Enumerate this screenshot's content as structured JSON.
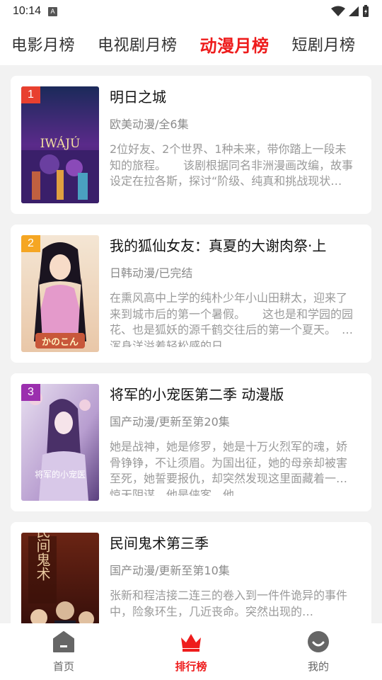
{
  "status_bar": {
    "time": "10:14",
    "notification_letter": "A"
  },
  "tabs": [
    {
      "label": "电影月榜",
      "active": false
    },
    {
      "label": "电视剧月榜",
      "active": false
    },
    {
      "label": "动漫月榜",
      "active": true
    },
    {
      "label": "短剧月榜",
      "active": false
    }
  ],
  "items": [
    {
      "rank": "1",
      "rank_color": "#e8402f",
      "title": "明日之城",
      "meta": "欧美动漫/全6集",
      "description": "2位好友、2个世界、1种未来，带你踏上一段未知的旅程。　　该剧根据同名非洲漫画改编，故事设定在拉各斯，探讨“阶级、纯真和挑战现状…",
      "poster_text": "IWÁJÚ",
      "poster_colors": [
        "#2a1650",
        "#6a2ea0"
      ]
    },
    {
      "rank": "2",
      "rank_color": "#f5a623",
      "title": "我的狐仙女友：真夏的大谢肉祭·上",
      "meta": "日韩动漫/已完结",
      "description": "在熏风高中上学的纯朴少年小山田耕太，迎来了来到城市后的第一个暑假。　　这也是和学园的园花、也是狐妖的源千鹤交往后的第一个夏天。　　浑身洋溢着轻松感的日…",
      "poster_text": "かのこん",
      "poster_colors": [
        "#f3e2cf",
        "#d98fc0"
      ]
    },
    {
      "rank": "3",
      "rank_color": "#9b2fae",
      "title": "将军的小宠医第二季 动漫版",
      "meta": "国产动漫/更新至第20集",
      "description": "她是战神，她是修罗，她是十万火烈军的魂，娇骨铮铮，不让须眉。为国出征，她的母亲却被害至死，她誓要报仇，却突然发现这里面藏着一个惊天阴谋。他是侠客，他…",
      "poster_text": "将军的小宠医",
      "poster_colors": [
        "#d8cde6",
        "#7b5a9e"
      ]
    },
    {
      "rank": "",
      "rank_color": "",
      "title": "民间鬼术第三季",
      "meta": "国产动漫/更新至第10集",
      "description": "张新和程洁接二连三的卷入到一件件诡异的事件中，险象环生，几近丧命。突然出现的…",
      "poster_text": "民间鬼术",
      "poster_colors": [
        "#5a1a12",
        "#2a0a08"
      ]
    }
  ],
  "bottom_nav": [
    {
      "label": "首页",
      "icon": "home-icon",
      "active": false
    },
    {
      "label": "排行榜",
      "icon": "crown-icon",
      "active": true
    },
    {
      "label": "我的",
      "icon": "profile-icon",
      "active": false
    }
  ],
  "colors": {
    "accent": "#ee1c1c",
    "background": "#f2f2f2",
    "card": "#ffffff",
    "muted_text": "#9a9a9a"
  }
}
